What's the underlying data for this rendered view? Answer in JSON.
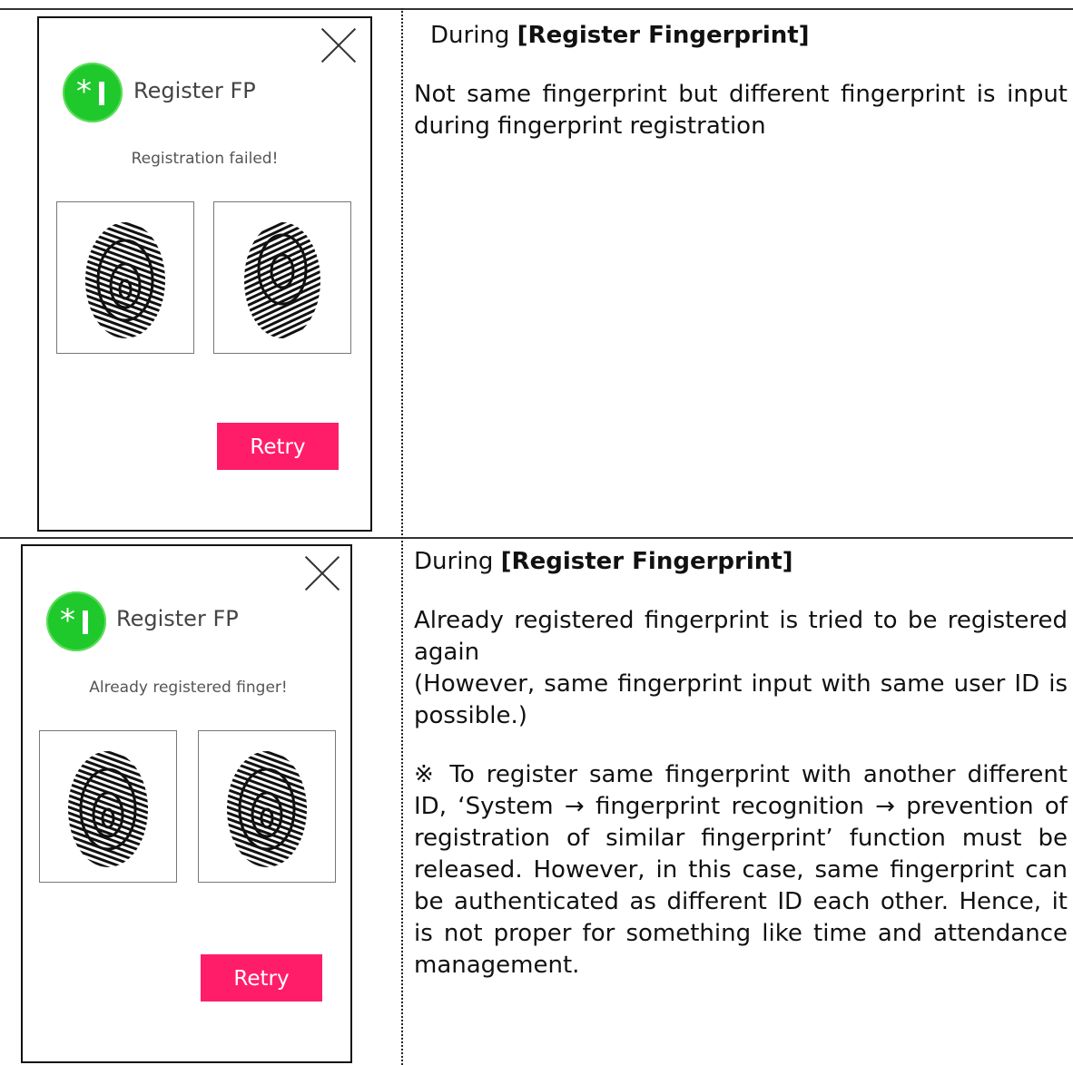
{
  "rows": [
    {
      "screen": {
        "title": "Register FP",
        "message": "Registration failed!",
        "retry_label": "Retry"
      },
      "description": {
        "heading_prefix": "During ",
        "heading_bold": "[Register Fingerprint]",
        "lines": [
          "Not same fingerprint but different fingerprint is input during fingerprint registration"
        ]
      }
    },
    {
      "screen": {
        "title": "Register FP",
        "message": "Already registered finger!",
        "retry_label": "Retry"
      },
      "description": {
        "heading_prefix": "During ",
        "heading_bold": "[Register Fingerprint]",
        "lines": [
          "Already registered fingerprint is tried to be registered again",
          "(However, same fingerprint input with same user ID is possible.)",
          "※ To register same fingerprint with another different ID, ‘System → fingerprint recognition → prevention of registration of similar fingerprint’ function must be released. However, in this case, same fingerprint can be authenticated as different ID each other. Hence, it is not proper for something like time and attendance management."
        ]
      }
    }
  ],
  "colors": {
    "retry_button": "#ff1d6a",
    "app_icon": "#1fc92b"
  },
  "icons": [
    "close-icon",
    "register-fp-app-icon",
    "fingerprint-image"
  ]
}
